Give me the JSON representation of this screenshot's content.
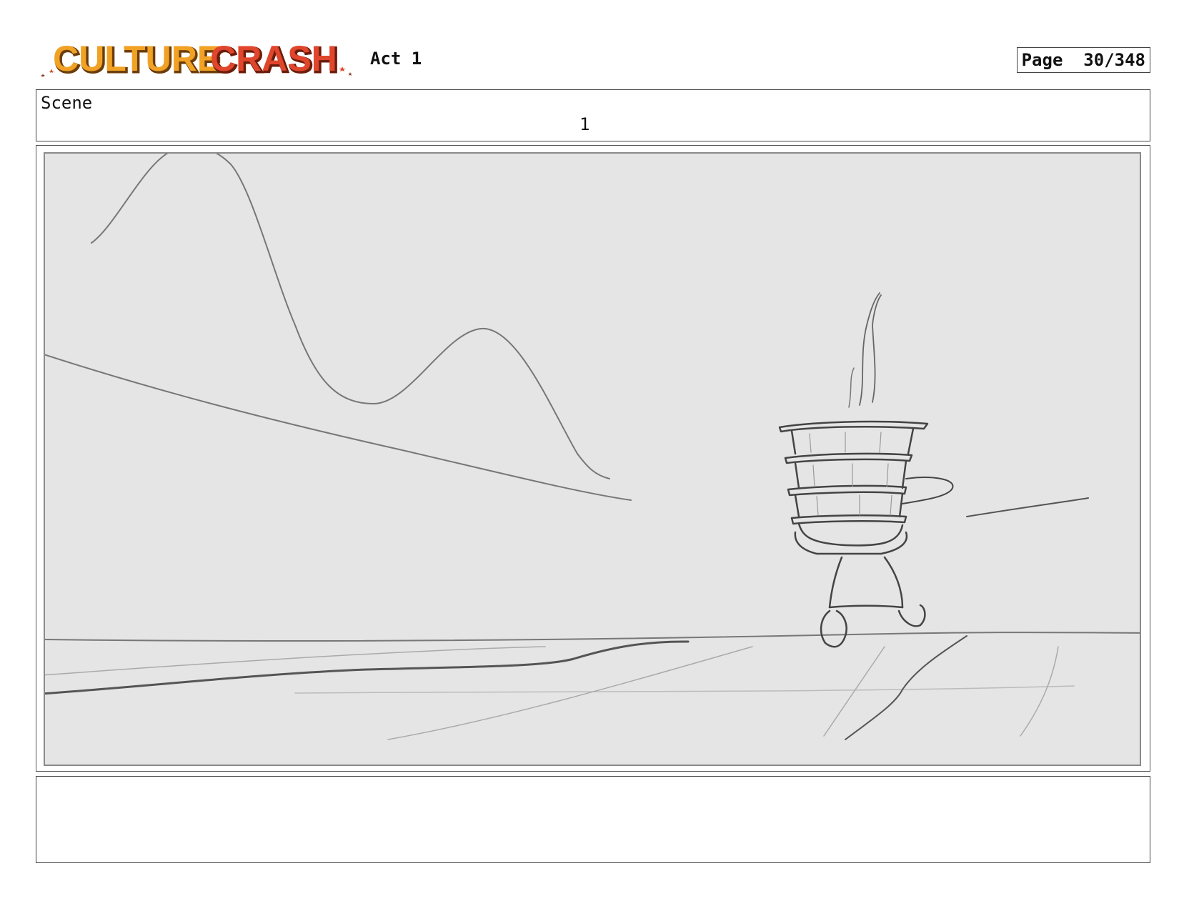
{
  "header": {
    "logo_text": "CULTURE CRASH",
    "act_label": "Act 1",
    "page_label": "Page",
    "page_number": "30/348"
  },
  "scene": {
    "label": "Scene",
    "number": "1"
  },
  "panel": {
    "icons": {
      "sketch": "storyboard-sketch-icon",
      "character": "walking-figure-carrying-stacked-pots-icon"
    }
  },
  "notes": {
    "text": ""
  },
  "colors": {
    "logo_orange": "#f1a225",
    "logo_red": "#e0462c",
    "panel_bg": "#e5e5e5",
    "sketch_line": "#555555"
  }
}
